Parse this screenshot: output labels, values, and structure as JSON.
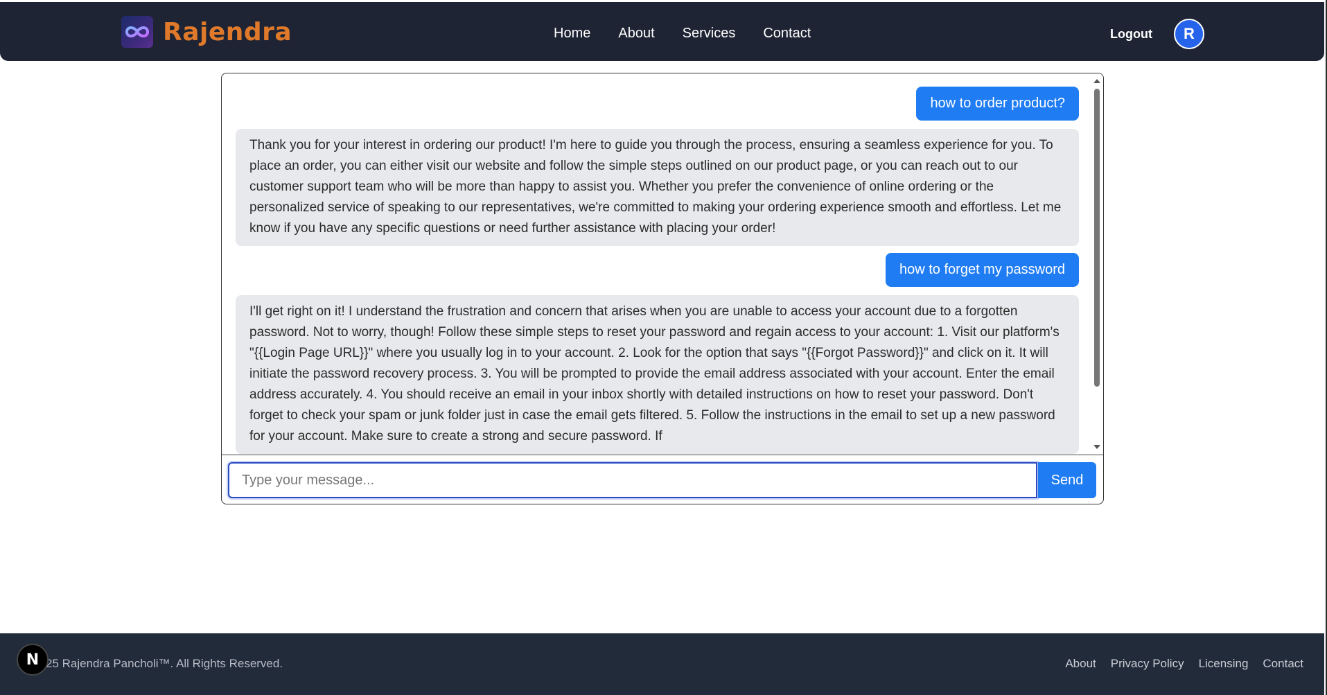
{
  "header": {
    "brand_name": "Rajendra",
    "nav": [
      "Home",
      "About",
      "Services",
      "Contact"
    ],
    "logout_label": "Logout",
    "avatar_initial": "R"
  },
  "chat": {
    "messages": [
      {
        "role": "user",
        "text": "how to order product?"
      },
      {
        "role": "bot",
        "text": "Thank you for your interest in ordering our product! I'm here to guide you through the process, ensuring a seamless experience for you. To place an order, you can either visit our website and follow the simple steps outlined on our product page, or you can reach out to our customer support team who will be more than happy to assist you. Whether you prefer the convenience of online ordering or the personalized service of speaking to our representatives, we're committed to making your ordering experience smooth and effortless. Let me know if you have any specific questions or need further assistance with placing your order!"
      },
      {
        "role": "user",
        "text": "how to forget my password"
      },
      {
        "role": "bot",
        "text": "I'll get right on it! I understand the frustration and concern that arises when you are unable to access your account due to a forgotten password. Not to worry, though! Follow these simple steps to reset your password and regain access to your account: 1. Visit our platform's \"{{Login Page URL}}\" where you usually log in to your account. 2. Look for the option that says \"{{Forgot Password}}\" and click on it. It will initiate the password recovery process. 3. You will be prompted to provide the email address associated with your account. Enter the email address accurately. 4. You should receive an email in your inbox shortly with detailed instructions on how to reset your password. Don't forget to check your spam or junk folder just in case the email gets filtered. 5. Follow the instructions in the email to set up a new password for your account. Make sure to create a strong and secure password. If"
      }
    ],
    "input_placeholder": "Type your message...",
    "send_label": "Send"
  },
  "footer": {
    "copyright": "25 Rajendra Pancholi™. All Rights Reserved.",
    "links": [
      "About",
      "Privacy Policy",
      "Licensing",
      "Contact"
    ],
    "badge_letter": "N"
  },
  "colors": {
    "navbar_bg": "#1e2433",
    "brand_accent": "#e07a2a",
    "primary": "#1f7cf2",
    "bot_bubble": "#e8e9ec",
    "footer_bg": "#222b3a"
  }
}
